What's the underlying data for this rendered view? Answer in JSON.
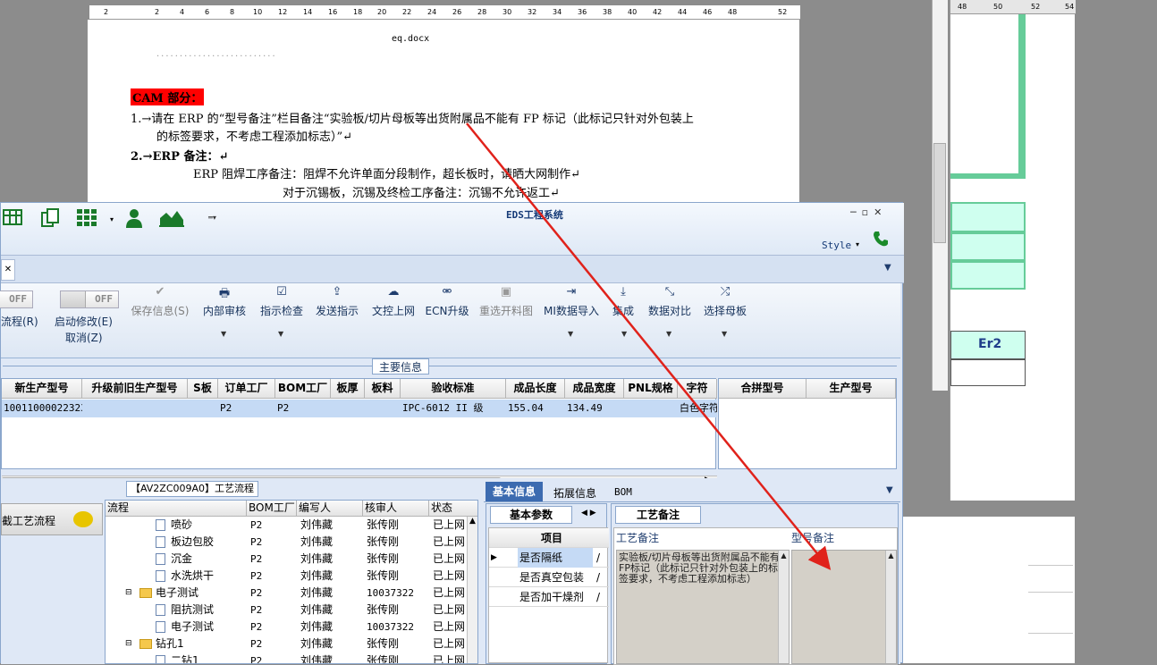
{
  "word": {
    "ruler_left": [
      "2",
      "2",
      "4",
      "6",
      "8",
      "10",
      "12",
      "14",
      "16",
      "18",
      "20",
      "22",
      "24",
      "26",
      "28",
      "30",
      "32",
      "34",
      "36",
      "38",
      "40",
      "42",
      "44",
      "46",
      "48",
      "52"
    ],
    "eq_caption": "eq.docx",
    "cam_heading": "CAM 部分：",
    "line1": "1.→请在 ERP 的“型号备注”栏目备注“实验板/切片母板等出货附属品不能有 FP 标记（此标记只针对外包装上",
    "line1b": "的标签要求，不考虑工程添加标志）”↵",
    "line2": "2.→ERP 备注：↵",
    "line3": "ERP 阻焊工序备注：阻焊不允许单面分段制作，超长板时，请晒大网制作↵",
    "line4": "对于沉锡板，沉锡及终检工序备注：沉锡不允许返工↵"
  },
  "right_window": {
    "ruler": [
      "48",
      "50",
      "52",
      "54"
    ],
    "cell_er2": "Er2"
  },
  "eds": {
    "title": "EDS工程系统",
    "style_label": "Style",
    "ribbon": {
      "toggle1": "OFF",
      "toggle2": "OFF",
      "flow_label": "流程(R)",
      "start_edit": "启动修改(E)",
      "cancel": "取消(Z)",
      "save_info": "保存信息(S)",
      "internal_review": "内部审核",
      "instruction_check": "指示检查",
      "send_instruction": "发送指示",
      "upload": "文控上网",
      "ecn_upgrade": "ECN升级",
      "reselect_drawing": "重选开料图",
      "mi_import": "MI数据导入",
      "integrate": "集成",
      "data_compare": "数据对比",
      "select_mother": "选择母板"
    },
    "main_info": {
      "label": "主要信息",
      "columns": [
        "新生产型号",
        "升级前旧生产型号",
        "S板",
        "订单工厂",
        "BOM工厂",
        "板厚",
        "板料",
        "验收标准",
        "成品长度",
        "成品宽度",
        "PNL规格",
        "字符"
      ],
      "row": [
        "10011000022323",
        "",
        "",
        "P2",
        "P2",
        "",
        "",
        "IPC-6012 II 级",
        "155.04",
        "134.49",
        "",
        "白色字符"
      ],
      "right_columns": [
        "合拼型号",
        "生产型号"
      ]
    },
    "flow": {
      "title": "【AV2ZC009A0】工艺流程",
      "left_button": "截工艺流程",
      "columns": [
        "流程",
        "BOM工厂",
        "编写人",
        "核审人",
        "状态"
      ],
      "rows": [
        {
          "name": "喷砂",
          "type": "doc",
          "bom": "P2",
          "writer": "刘伟藏",
          "reviewer": "张传刚",
          "status": "已上网"
        },
        {
          "name": "板边包胶",
          "type": "doc",
          "bom": "P2",
          "writer": "刘伟藏",
          "reviewer": "张传刚",
          "status": "已上网"
        },
        {
          "name": "沉金",
          "type": "doc",
          "bom": "P2",
          "writer": "刘伟藏",
          "reviewer": "张传刚",
          "status": "已上网"
        },
        {
          "name": "水洗烘干",
          "type": "doc",
          "bom": "P2",
          "writer": "刘伟藏",
          "reviewer": "张传刚",
          "status": "已上网"
        },
        {
          "name": "电子测试",
          "type": "folder",
          "bom": "P2",
          "writer": "刘伟藏",
          "reviewer": "10037322",
          "status": "已上网"
        },
        {
          "name": "阻抗测试",
          "type": "doc",
          "bom": "P2",
          "writer": "刘伟藏",
          "reviewer": "张传刚",
          "status": "已上网"
        },
        {
          "name": "电子测试",
          "type": "doc",
          "bom": "P2",
          "writer": "刘伟藏",
          "reviewer": "10037322",
          "status": "已上网"
        },
        {
          "name": "钻孔1",
          "type": "folder",
          "bom": "P2",
          "writer": "刘伟藏",
          "reviewer": "张传刚",
          "status": "已上网"
        },
        {
          "name": "二钻1",
          "type": "doc",
          "bom": "P2",
          "writer": "刘伟藏",
          "reviewer": "张传刚",
          "status": "已上网"
        }
      ]
    },
    "info": {
      "tabs": [
        "基本信息",
        "拓展信息",
        "BOM"
      ],
      "params_tab": "基本参数",
      "params_header": "项目",
      "params": [
        {
          "name": "是否隔纸",
          "value": "/"
        },
        {
          "name": "是否真空包装",
          "value": "/"
        },
        {
          "name": "是否加干燥剂",
          "value": "/"
        }
      ],
      "craft_tab": "工艺备注",
      "craft_col1": "工艺备注",
      "craft_col2": "型号备注",
      "craft_text": "实验板/切片母板等出货附属品不能有FP标记（此标记只针对外包装上的标签要求，不考虑工程添加标志）"
    }
  },
  "colors": {
    "highlight_red": "#ff0000",
    "arrow_red": "#e0221b",
    "eds_blue": "#dfe8f6",
    "tab_active": "#3c6bb0",
    "green_cell": "#cfffef"
  }
}
